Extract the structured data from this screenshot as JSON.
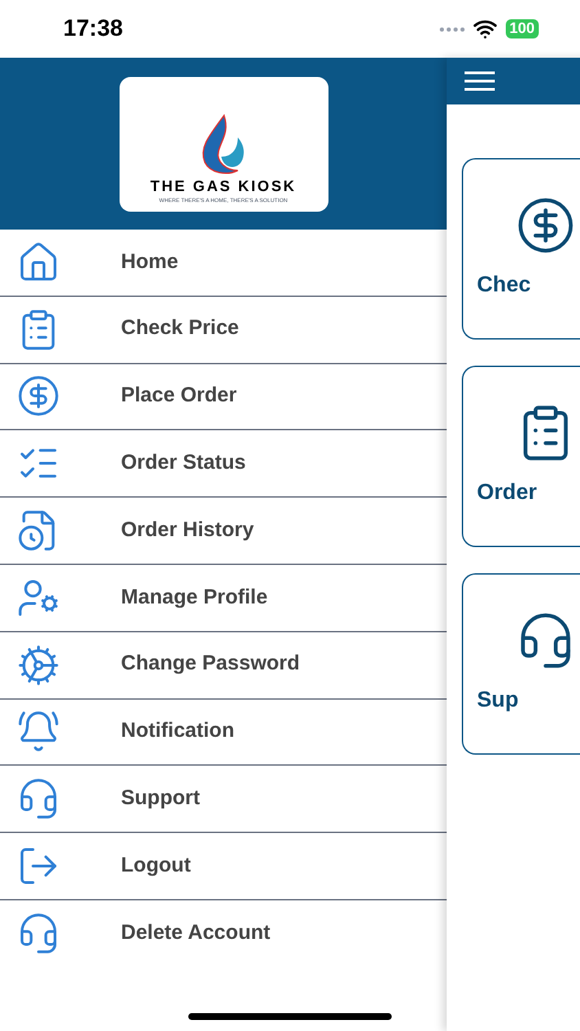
{
  "status_bar": {
    "time": "17:38",
    "battery": "100"
  },
  "logo": {
    "name": "THE GAS KIOSK",
    "tagline": "WHERE THERE'S A HOME, THERE'S A SOLUTION"
  },
  "menu": [
    {
      "label": "Home",
      "kind": "home"
    },
    {
      "label": "Check Price",
      "kind": "price"
    },
    {
      "label": "Place Order",
      "kind": "coin"
    },
    {
      "label": "Order Status",
      "kind": "status"
    },
    {
      "label": "Order History",
      "kind": "history"
    },
    {
      "label": "Manage Profile",
      "kind": "profile"
    },
    {
      "label": "Change Password",
      "kind": "gears"
    },
    {
      "label": "Notification",
      "kind": "bell"
    },
    {
      "label": "Support",
      "kind": "support"
    },
    {
      "label": "Logout",
      "kind": "logout"
    },
    {
      "label": "Delete Account",
      "kind": "support"
    }
  ],
  "cards": [
    {
      "label": "Chec",
      "kind": "coin"
    },
    {
      "label": "Order",
      "kind": "price"
    },
    {
      "label": "Sup",
      "kind": "support"
    }
  ]
}
